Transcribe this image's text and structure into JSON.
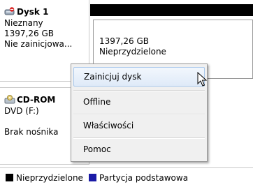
{
  "disk1": {
    "title": "Dysk 1",
    "type": "Nieznany",
    "size": "1397,26 GB",
    "status": "Nie zainicjowa..."
  },
  "volume": {
    "size": "1397,26 GB",
    "status": "Nieprzydzielone"
  },
  "cdrom": {
    "title": "CD-ROM",
    "drive": "DVD (F:)",
    "status": "Brak nośnika"
  },
  "context_menu": {
    "items": [
      "Zainicjuj dysk",
      "Offline",
      "Właściwości",
      "Pomoc"
    ]
  },
  "legend": {
    "unallocated": "Nieprzydzielone",
    "primary": "Partycja podstawowa",
    "unallocated_color": "#000000",
    "primary_color": "#1a1aa6"
  }
}
